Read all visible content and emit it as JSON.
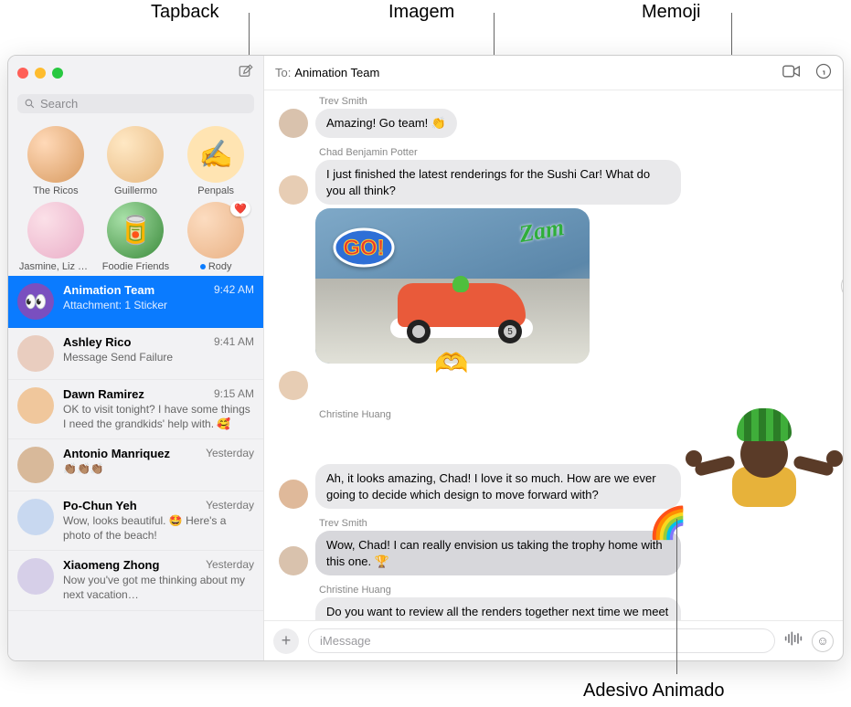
{
  "callouts": {
    "tapback": "Tapback",
    "imagem": "Imagem",
    "memoji": "Memoji",
    "adesivo": "Adesivo Animado"
  },
  "search_placeholder": "Search",
  "pinned": [
    {
      "name": "The Ricos"
    },
    {
      "name": "Guillermo"
    },
    {
      "name": "Penpals",
      "emoji": "✍️"
    },
    {
      "name": "Jasmine, Liz &…"
    },
    {
      "name": "Foodie Friends",
      "emoji": "🥫"
    },
    {
      "name": "Rody",
      "tapback_heart": "❤️",
      "status": true
    }
  ],
  "conversations": [
    {
      "name": "Animation Team",
      "time": "9:42 AM",
      "preview": "Attachment: 1 Sticker",
      "selected": true,
      "emoji": "👀"
    },
    {
      "name": "Ashley Rico",
      "time": "9:41 AM",
      "preview": "Message Send Failure"
    },
    {
      "name": "Dawn Ramirez",
      "time": "9:15 AM",
      "preview": "OK to visit tonight? I have some things I need the grandkids' help with. 🥰"
    },
    {
      "name": "Antonio Manriquez",
      "time": "Yesterday",
      "preview": "👏🏽👏🏽👏🏽"
    },
    {
      "name": "Po-Chun Yeh",
      "time": "Yesterday",
      "preview": "Wow, looks beautiful. 🤩 Here's a photo of the beach!"
    },
    {
      "name": "Xiaomeng Zhong",
      "time": "Yesterday",
      "preview": "Now you've got me thinking about my next vacation…"
    }
  ],
  "header": {
    "to_label": "To:",
    "to_name": "Animation Team"
  },
  "messages": {
    "m1_sender": "Trev Smith",
    "m1_text": "Amazing! Go team! 👏",
    "m2_sender": "Chad Benjamin Potter",
    "m2_text": "I just finished the latest renderings for the Sushi Car! What do you all think?",
    "wheel_number": "5",
    "zam": "Zam",
    "m3_sender": "Christine Huang",
    "m3_text": "Ah, it looks amazing, Chad! I love it so much. How are we ever going to decide which design to move forward with?",
    "m4_sender": "Trev Smith",
    "m4_text": "Wow, Chad! I can really envision us taking the trophy home with this one. 🏆",
    "m5_sender": "Christine Huang",
    "m5_text": "Do you want to review all the renders together next time we meet and decide on our favorites? We have so much amazing work now, just need to make some decisions."
  },
  "compose_placeholder": "iMessage"
}
